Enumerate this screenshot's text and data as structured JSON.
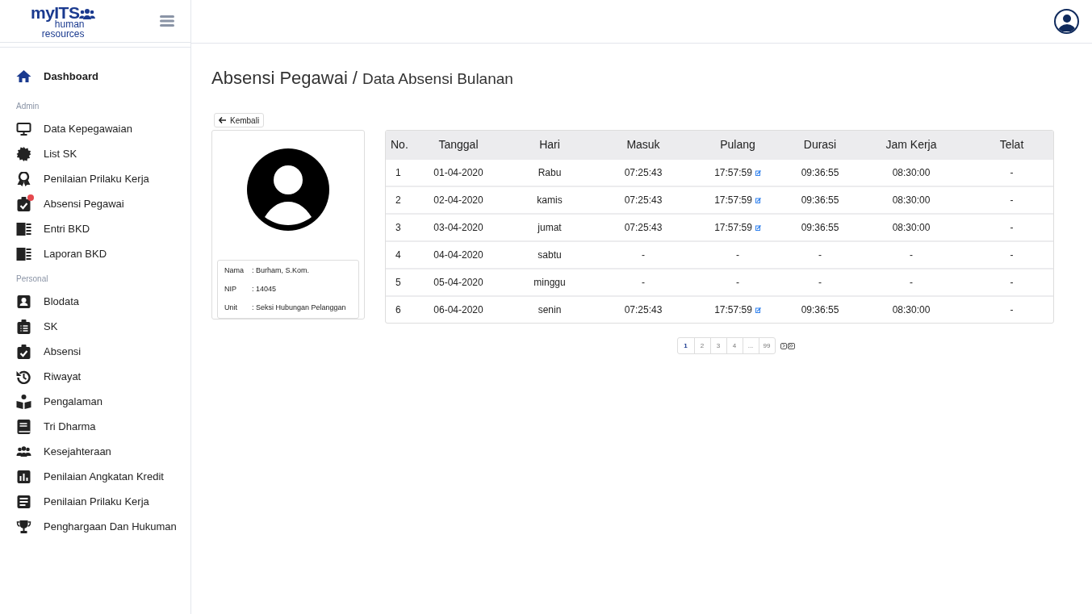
{
  "logo": {
    "brand": "myITS",
    "subtitle_1": "human",
    "subtitle_2": "resources"
  },
  "sidebar": {
    "items": [
      {
        "kind": "item",
        "label": "Dashboard",
        "selected": true,
        "badge": false
      },
      {
        "kind": "section",
        "label": "Admin"
      },
      {
        "kind": "item",
        "label": "Data Kepegawaian",
        "selected": false,
        "badge": false
      },
      {
        "kind": "item",
        "label": "List SK",
        "selected": false,
        "badge": false
      },
      {
        "kind": "item",
        "label": "Penilaian Prilaku Kerja",
        "selected": false,
        "badge": false
      },
      {
        "kind": "item",
        "label": "Absensi Pegawai",
        "selected": false,
        "badge": true
      },
      {
        "kind": "item",
        "label": "Entri BKD",
        "selected": false,
        "badge": false
      },
      {
        "kind": "item",
        "label": "Laporan BKD",
        "selected": false,
        "badge": false
      },
      {
        "kind": "section",
        "label": "Personal"
      },
      {
        "kind": "item",
        "label": "Blodata",
        "selected": false,
        "badge": false
      },
      {
        "kind": "item",
        "label": "SK",
        "selected": false,
        "badge": false
      },
      {
        "kind": "item",
        "label": "Absensi",
        "selected": false,
        "badge": false
      },
      {
        "kind": "item",
        "label": "Riwayat",
        "selected": false,
        "badge": false
      },
      {
        "kind": "item",
        "label": "Pengalaman",
        "selected": false,
        "badge": false
      },
      {
        "kind": "item",
        "label": "Tri Dharma",
        "selected": false,
        "badge": false
      },
      {
        "kind": "item",
        "label": "Kesejahteraan",
        "selected": false,
        "badge": false
      },
      {
        "kind": "item",
        "label": "Penilaian Angkatan Kredit",
        "selected": false,
        "badge": false
      },
      {
        "kind": "item",
        "label": "Penilaian Prilaku Kerja",
        "selected": false,
        "badge": false
      },
      {
        "kind": "item",
        "label": "Penghargaan Dan Hukuman",
        "selected": false,
        "badge": false
      }
    ]
  },
  "page": {
    "title": "Absensi Pegawai",
    "separator": "/",
    "subtitle": "Data Absensi Bulanan"
  },
  "back_button": "Kembali",
  "profile": {
    "fields": [
      {
        "label": "Nama",
        "value": ": Burham, S.Kom."
      },
      {
        "label": "NIP",
        "value": ": 14045"
      },
      {
        "label": "Unit",
        "value": ": Seksi Hubungan Pelanggan"
      }
    ]
  },
  "table": {
    "columns": [
      "No.",
      "Tanggal",
      "Hari",
      "Masuk",
      "Pulang",
      "Durasi",
      "Jam Kerja",
      "Telat"
    ],
    "rows": [
      {
        "cells": [
          "1",
          "01-04-2020",
          "Rabu",
          "07:25:43",
          "17:57:59",
          "09:36:55",
          "08:30:00",
          "-"
        ],
        "editable": true
      },
      {
        "cells": [
          "2",
          "02-04-2020",
          "kamis",
          "07:25:43",
          "17:57:59",
          "09:36:55",
          "08:30:00",
          "-"
        ],
        "editable": true
      },
      {
        "cells": [
          "3",
          "03-04-2020",
          "jumat",
          "07:25:43",
          "17:57:59",
          "09:36:55",
          "08:30:00",
          "-"
        ],
        "editable": true
      },
      {
        "cells": [
          "4",
          "04-04-2020",
          "sabtu",
          "-",
          "-",
          "-",
          "-",
          "-"
        ],
        "editable": false
      },
      {
        "cells": [
          "5",
          "05-04-2020",
          "minggu",
          "-",
          "-",
          "-",
          "-",
          "-"
        ],
        "editable": false
      },
      {
        "cells": [
          "6",
          "06-04-2020",
          "senin",
          "07:25:43",
          "17:57:59",
          "09:36:55",
          "08:30:00",
          "-"
        ],
        "editable": true
      }
    ]
  },
  "pagination": {
    "pages": [
      {
        "label": "1",
        "selected": true
      },
      {
        "label": "2",
        "selected": false
      },
      {
        "label": "3",
        "selected": false
      },
      {
        "label": "4",
        "selected": false
      },
      {
        "label": "...",
        "selected": false
      },
      {
        "label": "99",
        "selected": false
      }
    ]
  }
}
